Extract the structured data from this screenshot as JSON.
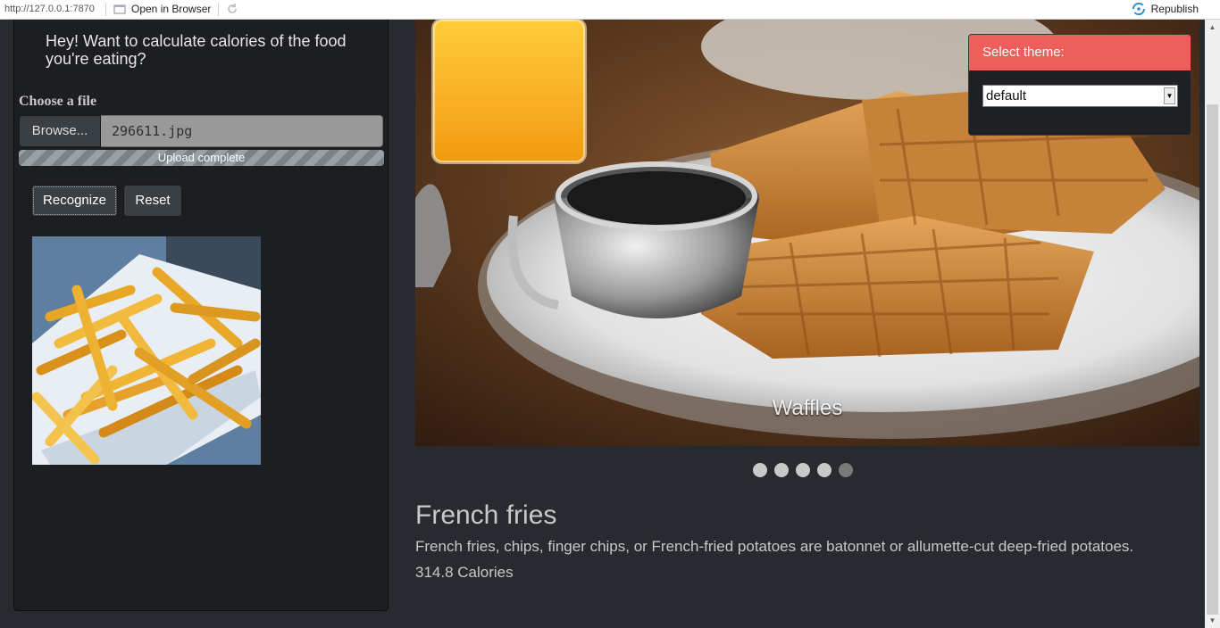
{
  "toolbar": {
    "url": "http://127.0.0.1:7870",
    "open_in_browser": "Open in Browser",
    "republish": "Republish"
  },
  "sidebar": {
    "intro": "Hey! Want to calculate calories of the food you're eating?",
    "choose_file_label": "Choose a file",
    "browse_label": "Browse...",
    "file_name": "296611.jpg",
    "upload_status": "Upload complete",
    "recognize_label": "Recognize",
    "reset_label": "Reset"
  },
  "carousel": {
    "caption": "Waffles",
    "slide_count": 5,
    "active_index": 4
  },
  "result": {
    "name": "French fries",
    "description": "French fries, chips, finger chips, or French-fried potatoes are batonnet or allumette-cut deep-fried potatoes.",
    "calories": "314.8 Calories"
  },
  "theme": {
    "header": "Select theme:",
    "selected": "default"
  },
  "colors": {
    "background": "#272b30",
    "panel": "#1c1e22",
    "accent": "#ee5f5b"
  }
}
